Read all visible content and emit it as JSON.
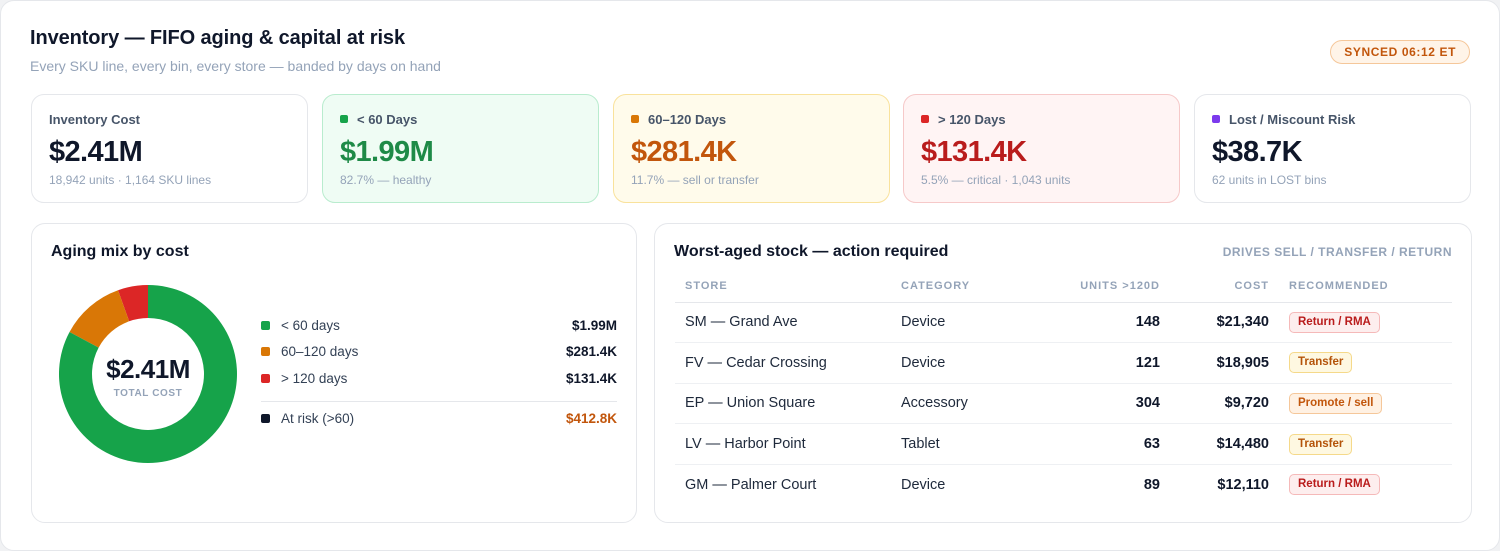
{
  "header": {
    "title": "Inventory — FIFO aging & capital at risk",
    "subtitle": "Every SKU line, every bin, every store — banded by days on hand",
    "sync_badge": "SYNCED 06:12 ET"
  },
  "kpis": [
    {
      "label": "Inventory Cost",
      "value": "$2.41M",
      "sub": "18,942 units · 1,164 SKU lines",
      "color": "#0f172a"
    },
    {
      "label": "< 60 Days",
      "value": "$1.99M",
      "sub": "82.7% — healthy",
      "color": "#1e8a47",
      "dot": "#16a34a"
    },
    {
      "label": "60–120 Days",
      "value": "$281.4K",
      "sub": "11.7% — sell or transfer",
      "color": "#c2560c",
      "dot": "#d97706"
    },
    {
      "label": "> 120 Days",
      "value": "$131.4K",
      "sub": "5.5% — critical · 1,043 units",
      "color": "#b91c1c",
      "dot": "#dc2626"
    },
    {
      "label": "Lost / Miscount Risk",
      "value": "$38.7K",
      "sub": "62 units in LOST bins",
      "color": "#0f172a",
      "dot": "#7c3aed"
    }
  ],
  "aging_panel": {
    "title": "Aging mix by cost",
    "center_value": "$2.41M",
    "center_label": "TOTAL COST",
    "legend": [
      {
        "name": "< 60 days",
        "value": "$1.99M",
        "color": "#16a34a"
      },
      {
        "name": "60–120 days",
        "value": "$281.4K",
        "color": "#d97706"
      },
      {
        "name": "> 120 days",
        "value": "$131.4K",
        "color": "#dc2626"
      }
    ],
    "risk": {
      "name": "At risk (>60)",
      "value": "$412.8K",
      "color": "#0f172a"
    }
  },
  "chart_data": {
    "type": "pie",
    "categories": [
      "< 60 days",
      "60–120 days",
      "> 120 days"
    ],
    "values": [
      1.99,
      0.2814,
      0.1314
    ],
    "colors": [
      "#16a34a",
      "#d97706",
      "#dc2626"
    ],
    "title": "Aging mix by cost"
  },
  "stock_panel": {
    "title": "Worst-aged stock — action required",
    "tag": "DRIVES SELL / TRANSFER / RETURN",
    "columns": [
      "STORE",
      "CATEGORY",
      "UNITS >120D",
      "COST",
      "RECOMMENDED"
    ],
    "rows": [
      {
        "store": "SM — Grand Ave",
        "category": "Device",
        "units": "148",
        "cost": "$21,340",
        "action": "Return / RMA",
        "kind": "return"
      },
      {
        "store": "FV — Cedar Crossing",
        "category": "Device",
        "units": "121",
        "cost": "$18,905",
        "action": "Transfer",
        "kind": "transfer"
      },
      {
        "store": "EP — Union Square",
        "category": "Accessory",
        "units": "304",
        "cost": "$9,720",
        "action": "Promote / sell",
        "kind": "promote"
      },
      {
        "store": "LV — Harbor Point",
        "category": "Tablet",
        "units": "63",
        "cost": "$14,480",
        "action": "Transfer",
        "kind": "transfer"
      },
      {
        "store": "GM — Palmer Court",
        "category": "Device",
        "units": "89",
        "cost": "$12,110",
        "action": "Return / RMA",
        "kind": "return"
      }
    ]
  }
}
